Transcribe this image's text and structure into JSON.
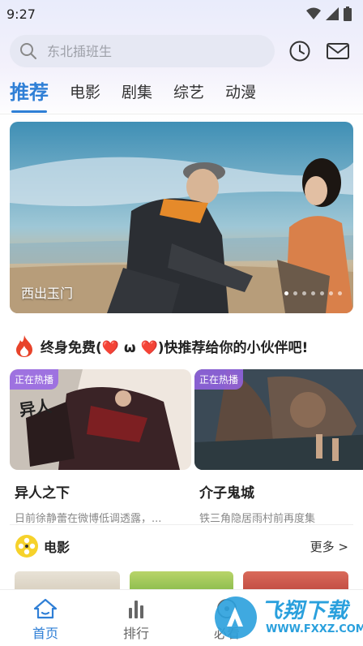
{
  "status": {
    "time": "9:27"
  },
  "search": {
    "placeholder": "东北插班生"
  },
  "tabs": [
    {
      "label": "推荐"
    },
    {
      "label": "电影"
    },
    {
      "label": "剧集"
    },
    {
      "label": "综艺"
    },
    {
      "label": "动漫"
    }
  ],
  "banner": {
    "title": "西出玉门",
    "dot_count": 7,
    "active_dot": 0
  },
  "promo": {
    "text": "终身免费(❤️ ω ❤️)快推荐给你的小伙伴吧!"
  },
  "cards": [
    {
      "badge": "正在热播",
      "title": "异人之下",
      "desc": "日前徐静蕾在微博低调透露，..."
    },
    {
      "badge": "正在热播",
      "title": "介子鬼城",
      "desc": "铁三角隐居雨村前再度集"
    }
  ],
  "section": {
    "title": "电影",
    "more": "更多 >"
  },
  "bottom_nav": [
    {
      "label": "首页"
    },
    {
      "label": "排行"
    },
    {
      "label": "必看"
    }
  ],
  "watermark": {
    "brand": "飞翔下载",
    "url": "WWW.FXXZ.COM"
  },
  "colors": {
    "accent": "#2f7fd6",
    "badge": "#9664e6"
  }
}
